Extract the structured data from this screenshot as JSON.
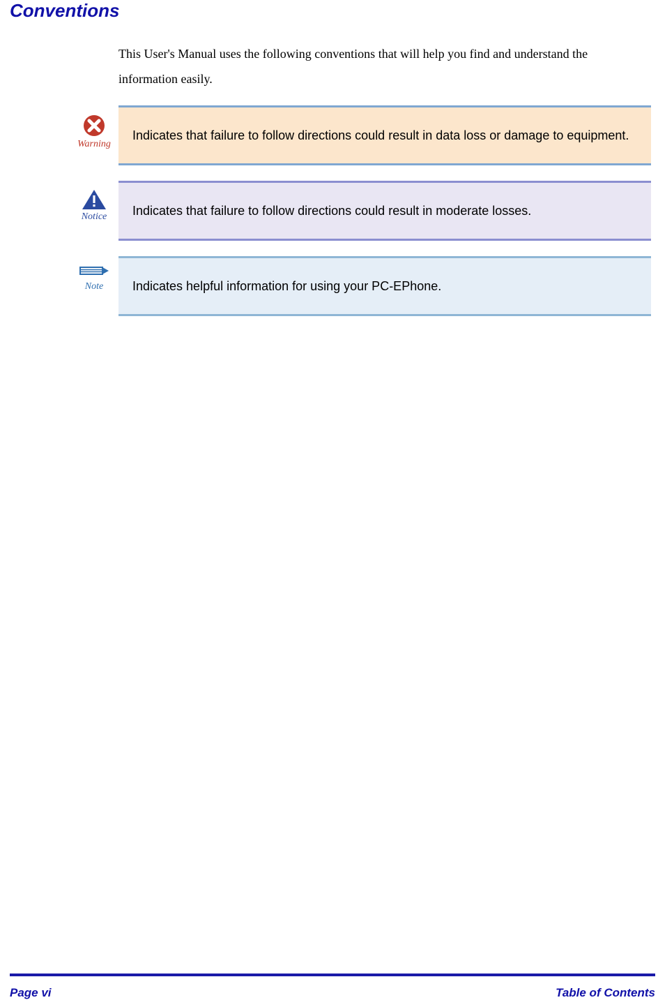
{
  "heading": "Conventions",
  "intro": "This User's Manual uses the following conventions that will help you find and understand the information easily.",
  "callouts": {
    "warning": {
      "label": "Warning",
      "text": "Indicates that failure to follow directions could result in data loss or damage to equipment."
    },
    "notice": {
      "label": "Notice",
      "text": "Indicates that failure to follow directions could result in moderate losses."
    },
    "note": {
      "label": "Note",
      "text": "Indicates helpful information for using your PC-EPhone."
    }
  },
  "footer": {
    "page": "Page vi",
    "section": "Table of Contents"
  },
  "colors": {
    "heading": "#1111a8",
    "warningIcon": "#c0392b",
    "noticeIcon": "#2a4aa0",
    "noteIcon": "#2f6fb0"
  }
}
